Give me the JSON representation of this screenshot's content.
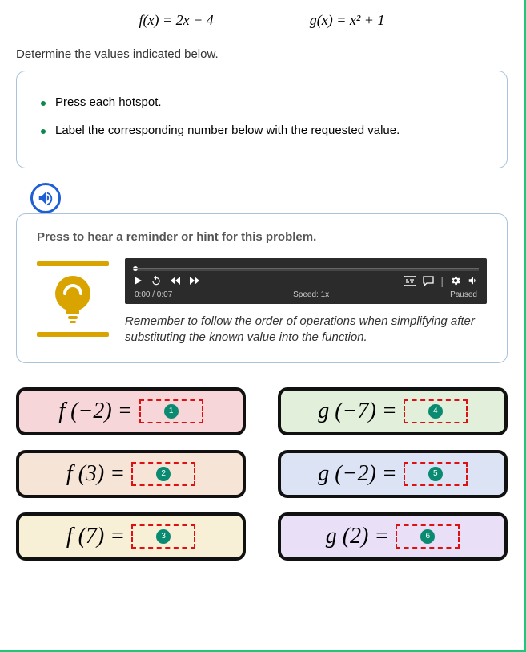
{
  "functions": {
    "f": "f(x) = 2x − 4",
    "g": "g(x) = x² + 1"
  },
  "prompt": "Determine the values indicated below.",
  "instructions": {
    "items": [
      "Press each hotspot.",
      "Label the corresponding number below with the requested value."
    ]
  },
  "audio_icon": "speaker-icon",
  "hint": {
    "title": "Press to hear a reminder or hint for this problem.",
    "player": {
      "time": "0:00 / 0:07",
      "speed": "Speed: 1x",
      "state": "Paused"
    },
    "text": "Remember to follow the order of operations when simplifying after substituting the known value into the function."
  },
  "hotspots": [
    {
      "label": "f (−2) =",
      "badge": "1",
      "color": "pink"
    },
    {
      "label": "g (−7) =",
      "badge": "4",
      "color": "green"
    },
    {
      "label": "f (3) =",
      "badge": "2",
      "color": "peach"
    },
    {
      "label": "g (−2) =",
      "badge": "5",
      "color": "blue"
    },
    {
      "label": "f (7) =",
      "badge": "3",
      "color": "yellow"
    },
    {
      "label": "g (2) =",
      "badge": "6",
      "color": "purple"
    }
  ],
  "colors": {
    "accent_green": "#1ec77a",
    "accent_blue": "#1d5fd6",
    "bulb": "#d9a400",
    "slot_border": "#d11",
    "badge_bg": "#0b8a72"
  }
}
